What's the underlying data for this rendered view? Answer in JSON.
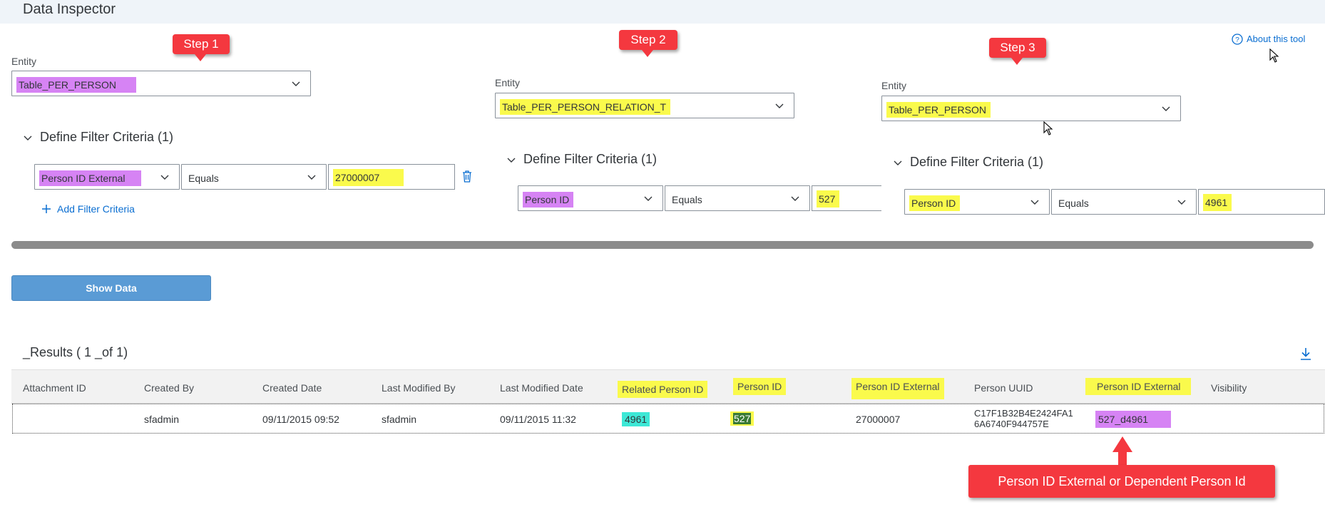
{
  "header": {
    "title": "Data Inspector"
  },
  "about": {
    "label": "About this tool"
  },
  "callouts": {
    "step1": "Step 1",
    "step2": "Step 2",
    "step3": "Step 3",
    "note": "Person ID External or  Dependent Person Id"
  },
  "colors": {
    "purple": "#d683f4",
    "yellow": "#fafa4c",
    "cyan": "#3de8d6",
    "callout_red": "#f4383f",
    "button_blue": "#5a9bd5",
    "link_blue": "#0a6ed1"
  },
  "panels": [
    {
      "entity_label": "Entity",
      "entity_value": "Table_PER_PERSON",
      "filter_title": "Define Filter Criteria (1)",
      "field": "Person ID External",
      "operator": "Equals",
      "value": "27000007",
      "add_filter": "Add Filter Criteria"
    },
    {
      "entity_label": "Entity",
      "entity_value": "Table_PER_PERSON_RELATION_T",
      "filter_title": "Define Filter Criteria (1)",
      "field": "Person ID",
      "operator": "Equals",
      "value": "527"
    },
    {
      "entity_label": "Entity",
      "entity_value": "Table_PER_PERSON",
      "filter_title": "Define Filter Criteria (1)",
      "field": "Person ID",
      "operator": "Equals",
      "value": "4961"
    }
  ],
  "show_data": "Show Data",
  "results": {
    "title": "_Results ( 1 _of 1)",
    "columns": [
      "Attachment ID",
      "Created By",
      "Created Date",
      "Last Modified By",
      "Last Modified Date",
      "Related Person ID",
      "Person ID",
      "Person ID External",
      "Person UUID",
      "Person ID External",
      "Visibility"
    ],
    "row": {
      "attachment_id": "",
      "created_by": "sfadmin",
      "created_date": "09/11/2015 09:52",
      "last_modified_by": "sfadmin",
      "last_modified_date": "09/11/2015 11:32",
      "related_person_id": "4961",
      "person_id": "527",
      "person_id_external": "27000007",
      "person_uuid_line1": "C17F1B32B4E2424FA1",
      "person_uuid_line2": "6A6740F944757E",
      "person_id_external_2": "527_d4961",
      "visibility": ""
    }
  }
}
